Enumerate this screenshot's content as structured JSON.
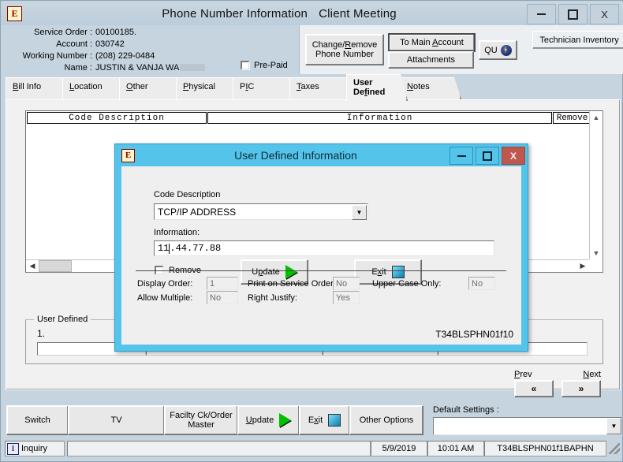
{
  "window": {
    "icon": "e-app-icon",
    "title_primary": "Phone Number Information",
    "title_secondary": "Client Meeting",
    "minimize": "–",
    "maximize": "□",
    "close": "X"
  },
  "header": {
    "fields": [
      {
        "label": "Service Order :",
        "value": "00100185."
      },
      {
        "label": "Account :",
        "value": "030742"
      },
      {
        "label": "Working Number :",
        "value": "(208) 229-0484"
      },
      {
        "label": "Name :",
        "value": "JUSTIN & VANJA WA"
      }
    ],
    "prepaid_label": "Pre-Paid",
    "prepaid_checked": false,
    "buttons": {
      "change_remove_line1": "Change/Remove",
      "change_remove_line2": "Phone Number",
      "to_main_account": "To Main Account",
      "attachments": "Attachments",
      "qu": "QU",
      "technician_inventory": "Technician Inventory"
    }
  },
  "tabs": [
    {
      "label": "Bill Info",
      "active": false
    },
    {
      "label": "Location",
      "active": false
    },
    {
      "label": "Other",
      "active": false
    },
    {
      "label": "Physical",
      "active": false
    },
    {
      "label": "PIC",
      "active": false
    },
    {
      "label": "Taxes",
      "active": false
    },
    {
      "label": "User Defined",
      "active": true
    },
    {
      "label": "Notes",
      "active": false
    }
  ],
  "grid": {
    "headers": [
      "Code Description",
      "Information",
      "Remove"
    ],
    "rows": []
  },
  "user_defined_group": {
    "title": "User Defined",
    "row_number": "1.",
    "values": [
      "",
      "",
      "",
      ""
    ]
  },
  "pager": {
    "prev_label": "Prev",
    "next_label": "Next",
    "prev_button": "«",
    "next_button": "»"
  },
  "toolbar": {
    "switch": "Switch",
    "tv": "TV",
    "facility_line1": "Facilty Ck/Order",
    "facility_line2": "Master",
    "update": "Update",
    "exit": "Exit",
    "other_options": "Other Options",
    "default_settings_label": "Default Settings :",
    "default_settings_value": ""
  },
  "statusbar": {
    "inquiry": "Inquiry",
    "message": "",
    "date": "5/9/2019",
    "time": "10:01 AM",
    "program": "T34BLSPHN01f1BAPHN"
  },
  "dialog": {
    "icon": "e-app-icon",
    "title": "User Defined Information",
    "minimize": "–",
    "maximize": "□",
    "close": "X",
    "code_description_label": "Code Description",
    "code_description_value": "TCP/IP ADDRESS",
    "information_label": "Information:",
    "information_value_before_caret": "11",
    "information_value_after_caret": ".44.77.88",
    "remove_label": "Remove",
    "remove_checked": false,
    "update_label": "Update",
    "exit_label": "Exit",
    "properties": [
      {
        "label": "Display Order:",
        "value": "1"
      },
      {
        "label": "Print on Service Order:",
        "value": "No"
      },
      {
        "label": "Upper Case Only:",
        "value": "No"
      },
      {
        "label": "Allow Multiple:",
        "value": "No"
      },
      {
        "label": "Right Justify:",
        "value": "Yes"
      }
    ],
    "program_code": "T34BLSPHN01f10"
  },
  "colors": {
    "window_chrome": "#c5d4de",
    "dialog_frame": "#55c4ea",
    "close_button": "#c0574f",
    "panel": "#efefef",
    "accent_green": "#00c000",
    "accent_blue": "#0b7fa8"
  }
}
